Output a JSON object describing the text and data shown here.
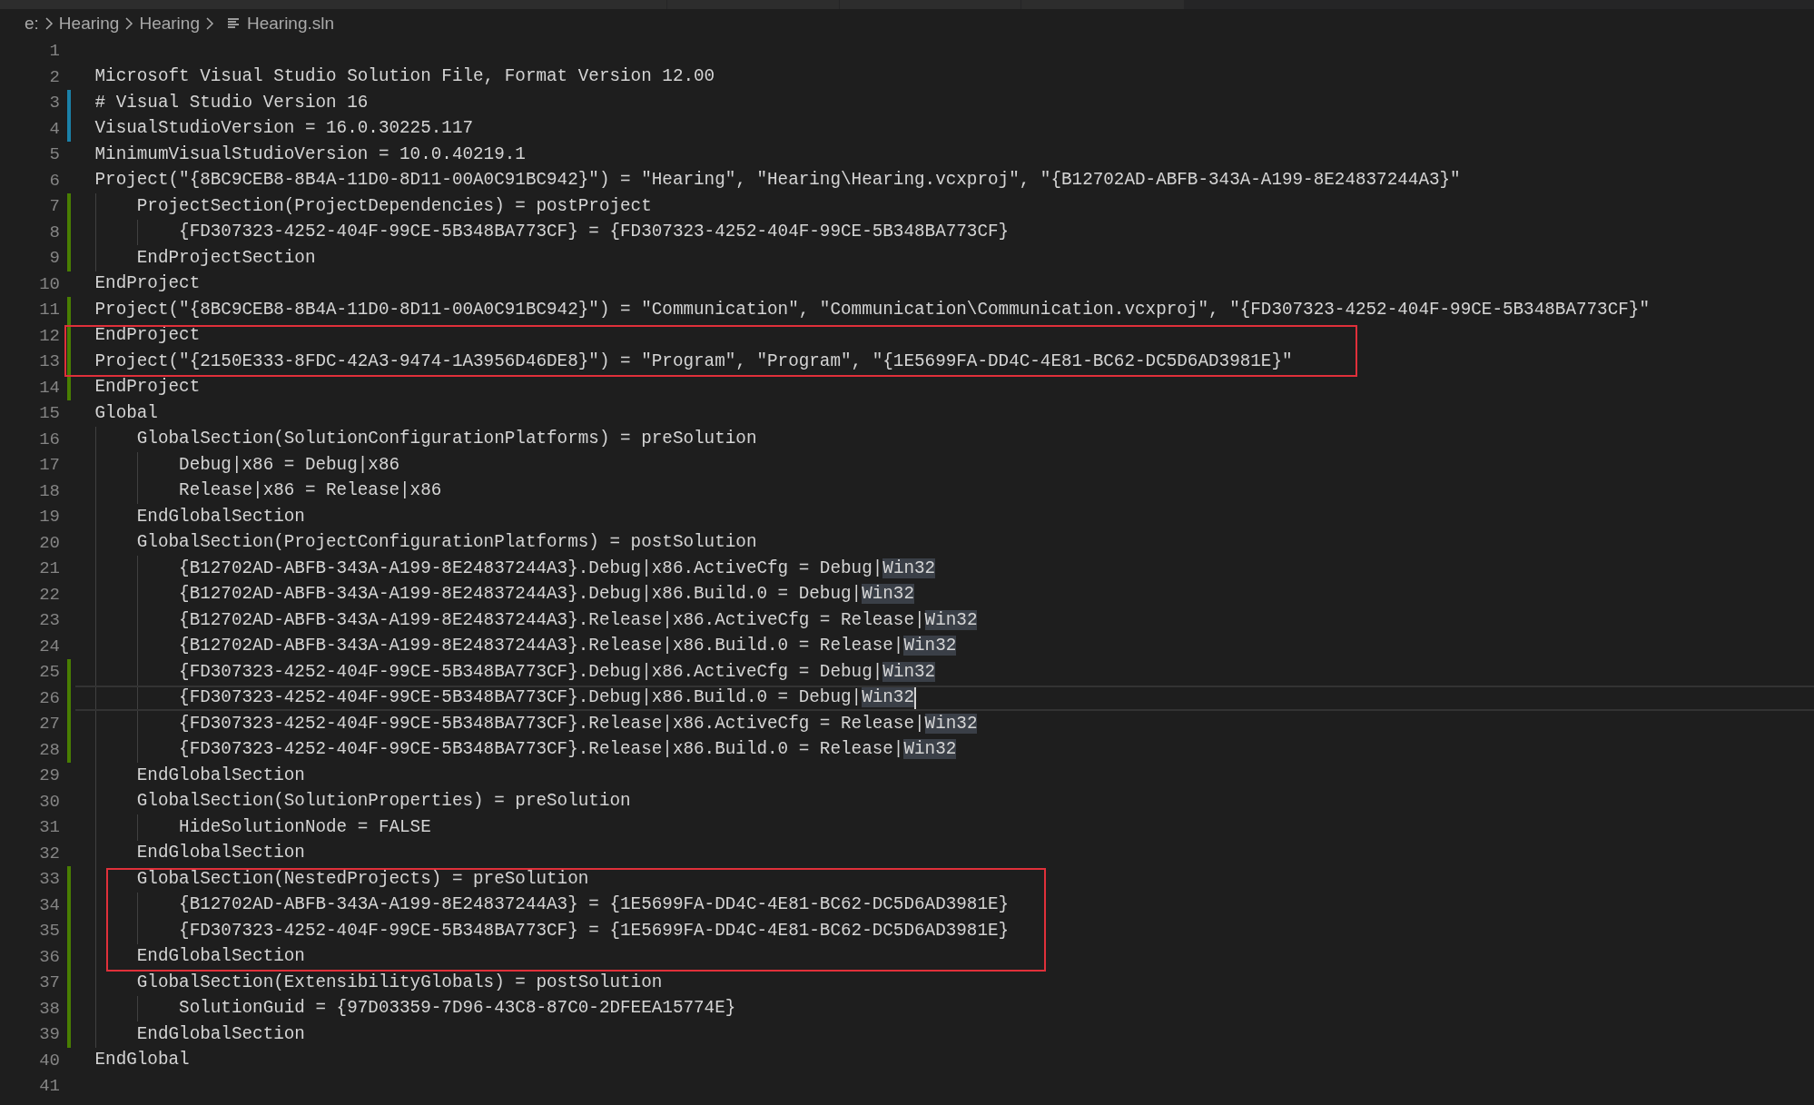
{
  "breadcrumb": {
    "parts": [
      "e:",
      "Hearing",
      "Hearing"
    ],
    "file": "Hearing.sln"
  },
  "editor": {
    "lines": [
      {
        "number": "1",
        "kind": "none",
        "current": false,
        "framed": false
      },
      {
        "number": "2",
        "text": "Microsoft Visual Studio Solution File, Format Version 12.00",
        "kind": "none",
        "current": false,
        "framed": false
      },
      {
        "number": "3",
        "text": "# Visual Studio Version 16",
        "kind": "modified",
        "current": false,
        "framed": false
      },
      {
        "number": "4",
        "text": "VisualStudioVersion = 16.0.30225.117",
        "kind": "modified",
        "current": false,
        "framed": false
      },
      {
        "number": "5",
        "text": "MinimumVisualStudioVersion = 10.0.40219.1",
        "kind": "none",
        "current": false,
        "framed": false
      },
      {
        "number": "6",
        "text": "Project(\"{8BC9CEB8-8B4A-11D0-8D11-00A0C91BC942}\") = \"Hearing\", \"Hearing\\Hearing.vcxproj\", \"{B12702AD-ABFB-343A-A199-8E24837244A3}\"",
        "kind": "none",
        "current": false,
        "framed": false
      },
      {
        "number": "7",
        "text": "    ProjectSection(ProjectDependencies) = postProject",
        "kind": "added",
        "current": false,
        "framed": false
      },
      {
        "number": "8",
        "text": "        {FD307323-4252-404F-99CE-5B348BA773CF} = {FD307323-4252-404F-99CE-5B348BA773CF}",
        "kind": "added",
        "current": false,
        "framed": false
      },
      {
        "number": "9",
        "text": "    EndProjectSection",
        "kind": "added",
        "current": false,
        "framed": false
      },
      {
        "number": "10",
        "text": "EndProject",
        "kind": "none",
        "current": false,
        "framed": false
      },
      {
        "number": "11",
        "text": "Project(\"{8BC9CEB8-8B4A-11D0-8D11-00A0C91BC942}\") = \"Communication\", \"Communication\\Communication.vcxproj\", \"{FD307323-4252-404F-99CE-5B348BA773CF}\"",
        "kind": "added",
        "current": false,
        "framed": false
      },
      {
        "number": "12",
        "text": "EndProject",
        "kind": "added",
        "current": false,
        "framed": true
      },
      {
        "number": "13",
        "text": "Project(\"{2150E333-8FDC-42A3-9474-1A3956D46DE8}\") = \"Program\", \"Program\", \"{1E5699FA-DD4C-4E81-BC62-DC5D6AD3981E}\"",
        "kind": "added",
        "current": false,
        "framed": true
      },
      {
        "number": "14",
        "text": "EndProject",
        "kind": "added",
        "current": false,
        "framed": false
      },
      {
        "number": "15",
        "text": "Global",
        "kind": "none",
        "current": false,
        "framed": false
      },
      {
        "number": "16",
        "text": "    GlobalSection(SolutionConfigurationPlatforms) = preSolution",
        "kind": "none",
        "current": false,
        "framed": false
      },
      {
        "number": "17",
        "text": "        Debug|x86 = Debug|x86",
        "kind": "none",
        "current": false,
        "framed": false
      },
      {
        "number": "18",
        "text": "        Release|x86 = Release|x86",
        "kind": "none",
        "current": false,
        "framed": false
      },
      {
        "number": "19",
        "text": "    EndGlobalSection",
        "kind": "none",
        "current": false,
        "framed": false
      },
      {
        "number": "20",
        "text": "    GlobalSection(ProjectConfigurationPlatforms) = postSolution",
        "kind": "none",
        "current": false,
        "framed": false
      },
      {
        "number": "21",
        "segments": [
          {
            "text": "        {B12702AD-ABFB-343A-A199-8E24837244A3}.Debug|x86.ActiveCfg = Debug|",
            "match": false
          },
          {
            "text": "Win32",
            "match": true
          }
        ],
        "kind": "none",
        "current": false,
        "framed": false
      },
      {
        "number": "22",
        "segments": [
          {
            "text": "        {B12702AD-ABFB-343A-A199-8E24837244A3}.Debug|x86.Build.0 = Debug|",
            "match": false
          },
          {
            "text": "Win32",
            "match": true
          }
        ],
        "kind": "none",
        "current": false,
        "framed": false
      },
      {
        "number": "23",
        "segments": [
          {
            "text": "        {B12702AD-ABFB-343A-A199-8E24837244A3}.Release|x86.ActiveCfg = Release|",
            "match": false
          },
          {
            "text": "Win32",
            "match": true
          }
        ],
        "kind": "none",
        "current": false,
        "framed": false
      },
      {
        "number": "24",
        "segments": [
          {
            "text": "        {B12702AD-ABFB-343A-A199-8E24837244A3}.Release|x86.Build.0 = Release|",
            "match": false
          },
          {
            "text": "Win32",
            "match": true
          }
        ],
        "kind": "none",
        "current": false,
        "framed": false
      },
      {
        "number": "25",
        "segments": [
          {
            "text": "        {FD307323-4252-404F-99CE-5B348BA773CF}.Debug|x86.ActiveCfg = Debug|",
            "match": false
          },
          {
            "text": "Win32",
            "match": true
          }
        ],
        "kind": "added",
        "current": false,
        "framed": false
      },
      {
        "number": "26",
        "segments": [
          {
            "text": "        {FD307323-4252-404F-99CE-5B348BA773CF}.Debug|x86.Build.0 = Debug|",
            "match": false
          },
          {
            "text": "Win32",
            "match": true
          }
        ],
        "kind": "added",
        "current": true,
        "framed": false
      },
      {
        "number": "27",
        "segments": [
          {
            "text": "        {FD307323-4252-404F-99CE-5B348BA773CF}.Release|x86.ActiveCfg = Release|",
            "match": false
          },
          {
            "text": "Win32",
            "match": true
          }
        ],
        "kind": "added",
        "current": false,
        "framed": false
      },
      {
        "number": "28",
        "segments": [
          {
            "text": "        {FD307323-4252-404F-99CE-5B348BA773CF}.Release|x86.Build.0 = Release|",
            "match": false
          },
          {
            "text": "Win32",
            "match": true
          }
        ],
        "kind": "added",
        "current": false,
        "framed": false
      },
      {
        "number": "29",
        "text": "    EndGlobalSection",
        "kind": "none",
        "current": false,
        "framed": false
      },
      {
        "number": "30",
        "text": "    GlobalSection(SolutionProperties) = preSolution",
        "kind": "none",
        "current": false,
        "framed": false
      },
      {
        "number": "31",
        "text": "        HideSolutionNode = FALSE",
        "kind": "none",
        "current": false,
        "framed": false
      },
      {
        "number": "32",
        "text": "    EndGlobalSection",
        "kind": "none",
        "current": false,
        "framed": false
      },
      {
        "number": "33",
        "text": "    GlobalSection(NestedProjects) = preSolution",
        "kind": "added",
        "current": false,
        "framed": true
      },
      {
        "number": "34",
        "text": "        {B12702AD-ABFB-343A-A199-8E24837244A3} = {1E5699FA-DD4C-4E81-BC62-DC5D6AD3981E}",
        "kind": "added",
        "current": false,
        "framed": true
      },
      {
        "number": "35",
        "text": "        {FD307323-4252-404F-99CE-5B348BA773CF} = {1E5699FA-DD4C-4E81-BC62-DC5D6AD3981E}",
        "kind": "added",
        "current": false,
        "framed": true
      },
      {
        "number": "36",
        "text": "    EndGlobalSection",
        "kind": "added",
        "current": false,
        "framed": true
      },
      {
        "number": "37",
        "text": "    GlobalSection(ExtensibilityGlobals) = postSolution",
        "kind": "added",
        "current": false,
        "framed": false
      },
      {
        "number": "38",
        "text": "        SolutionGuid = {97D03359-7D96-43C8-87C0-2DFEEA15774E}",
        "kind": "added",
        "current": false,
        "framed": false
      },
      {
        "number": "39",
        "text": "    EndGlobalSection",
        "kind": "added",
        "current": false,
        "framed": false
      },
      {
        "number": "40",
        "text": "EndGlobal",
        "kind": "none",
        "current": false,
        "framed": false
      },
      {
        "number": "41",
        "kind": "none",
        "current": false,
        "framed": false
      }
    ]
  }
}
